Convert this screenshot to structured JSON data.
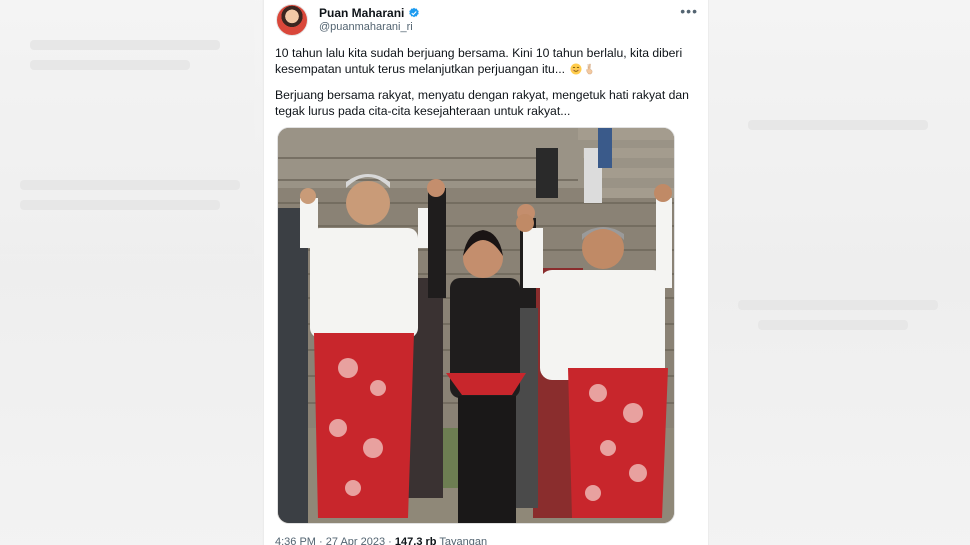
{
  "tweet": {
    "display_name": "Puan Maharani",
    "handle": "@puanmaharani_ri",
    "verified": true,
    "paragraphs": [
      "10 tahun lalu kita sudah berjuang bersama. Kini 10 tahun berlalu, kita diberi kesempatan untuk terus melanjutkan perjuangan itu...",
      "Berjuang bersama rakyat, menyatu dengan rakyat, mengetuk hati rakyat dan tegak lurus pada cita-cita kesejahteraan untuk rakyat..."
    ],
    "emojis": [
      "smiling-face-icon",
      "victory-hand-icon"
    ],
    "time": "4:36 PM",
    "date": "27 Apr 2023",
    "views_count": "147,3 rb",
    "views_label": "Tayangan",
    "separator": "·"
  },
  "colors": {
    "text": "#0f1419",
    "secondary": "#536471",
    "verified": "#1d9bf0",
    "sarong_red": "#c8262c"
  }
}
